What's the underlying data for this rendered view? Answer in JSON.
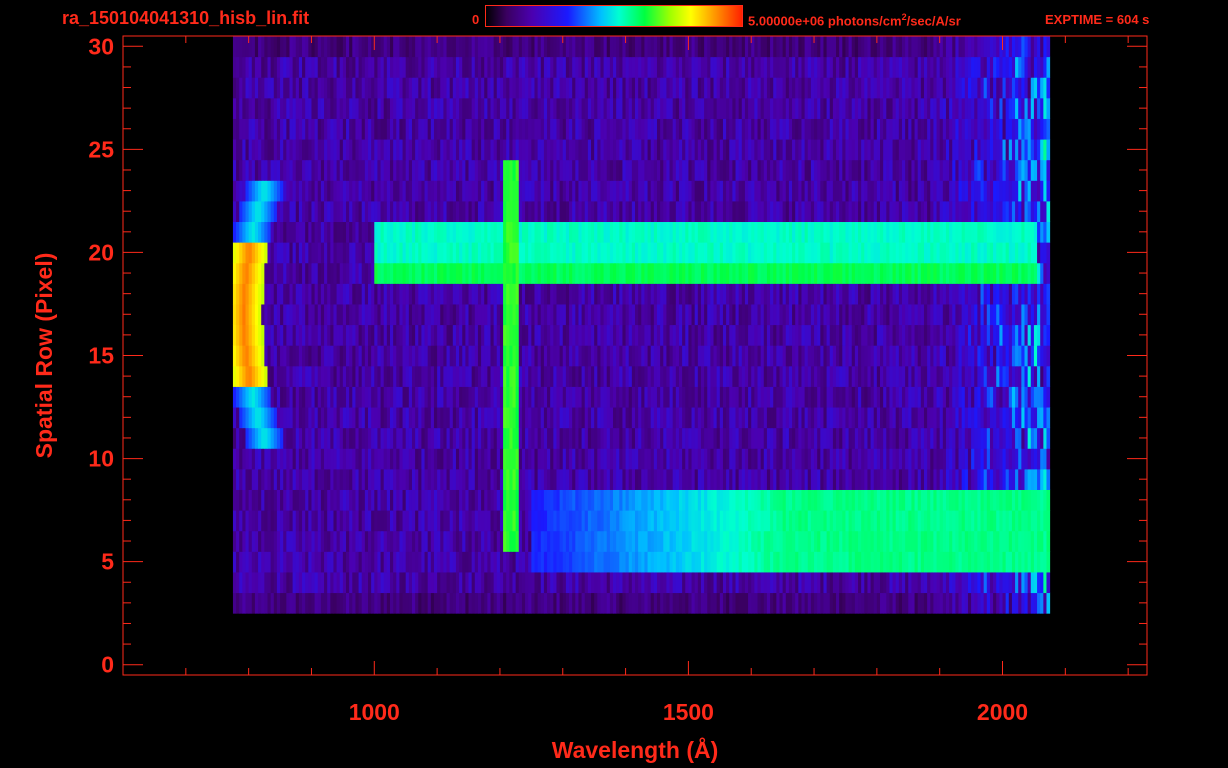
{
  "header": {
    "filename": "ra_150104041310_hisb_lin.fit",
    "colorbar_min": "0",
    "colorbar_max_value": "5.00000e+06 photons/cm",
    "colorbar_max_sup": "2",
    "colorbar_max_rest": "/sec/A/sr",
    "exptime": "EXPTIME = 604 s"
  },
  "colors": {
    "axis": "#ff2a1a",
    "background": "#000000"
  },
  "chart_data": {
    "type": "heatmap",
    "title": "ra_150104041310_hisb_lin.fit",
    "xlabel": "Wavelength (Å)",
    "ylabel": "Spatial Row (Pixel)",
    "xlim": [
      600,
      2230
    ],
    "ylim": [
      -0.5,
      30.5
    ],
    "xticks": [
      1000,
      1500,
      2000
    ],
    "xtick_labels": [
      "1000",
      "1500",
      "2000"
    ],
    "yticks": [
      0,
      5,
      10,
      15,
      20,
      25,
      30
    ],
    "ytick_labels": [
      "0",
      "5",
      "10",
      "15",
      "20",
      "25",
      "30"
    ],
    "colorbar": {
      "min": 0,
      "max": 5000000,
      "units": "photons/cm^2/sec/A/sr",
      "colormap": "rainbow"
    },
    "data_extent_x": [
      775,
      2075
    ],
    "features": [
      {
        "name": "arc",
        "x_center": 790,
        "row_range": [
          11,
          23
        ],
        "intensity": 0.92
      },
      {
        "name": "vertical-line",
        "x": 1216,
        "row_range": [
          6,
          24
        ],
        "intensity": 0.62
      },
      {
        "name": "continuum-upper",
        "x_range": [
          1000,
          2050
        ],
        "row_range": [
          19,
          21
        ],
        "intensity": 0.55
      },
      {
        "name": "continuum-lower",
        "x_range": [
          1250,
          2075
        ],
        "row_range": [
          5,
          8
        ],
        "intensity": 0.5
      }
    ]
  }
}
